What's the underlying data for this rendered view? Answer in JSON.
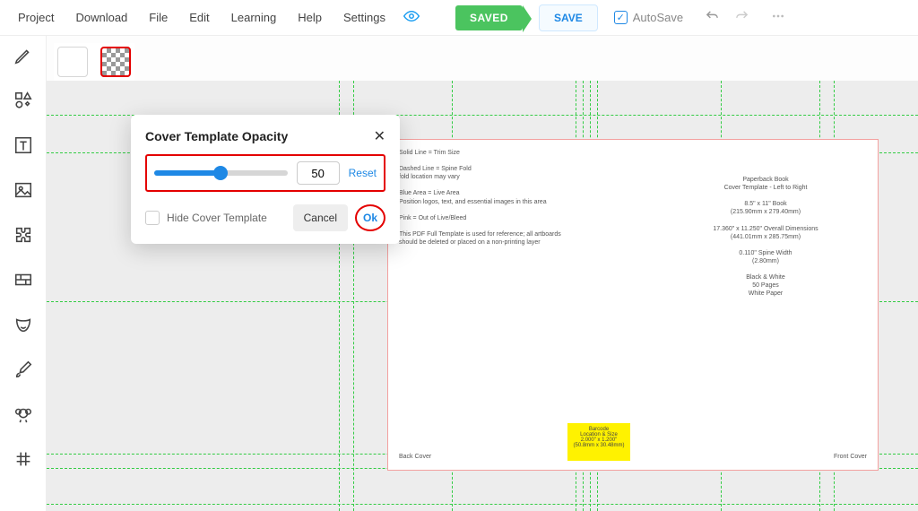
{
  "menu": [
    "Project",
    "Download",
    "File",
    "Edit",
    "Learning",
    "Help",
    "Settings"
  ],
  "topbar": {
    "saved": "SAVED",
    "save": "SAVE",
    "autosave": "AutoSave"
  },
  "dialog": {
    "title": "Cover Template Opacity",
    "value": "50",
    "reset": "Reset",
    "hide": "Hide Cover Template",
    "cancel": "Cancel",
    "ok": "Ok"
  },
  "cover": {
    "right_lines": [
      "Paperback Book",
      "Cover Template - Left to Right",
      "",
      "8.5\" x 11\" Book",
      "(215.90mm x 279.40mm)",
      "",
      "17.360\" x 11.250\" Overall Dimensions",
      "(441.01mm x 285.75mm)",
      "",
      "0.110\" Spine Width",
      "(2.80mm)",
      "",
      "Black & White",
      "50 Pages",
      "White Paper"
    ],
    "left_lines": [
      "Solid Line = Trim Size",
      "",
      "Dashed Line = Spine Fold",
      "fold location may vary",
      "",
      "Blue Area = Live Area",
      "Position logos, text, and essential images in this area",
      "",
      "Pink = Out of Live/Bleed",
      "",
      "This PDF Full Template is used for reference; all artboards",
      "should be deleted or placed on a non-printing layer"
    ],
    "barcode": {
      "l1": "Barcode",
      "l2": "Location & Size",
      "l3": "2.000\" x 1.200\"",
      "l4": "(50.8mm x 30.48mm)"
    },
    "back_cover": "Back Cover",
    "front_cover": "Front Cover"
  }
}
